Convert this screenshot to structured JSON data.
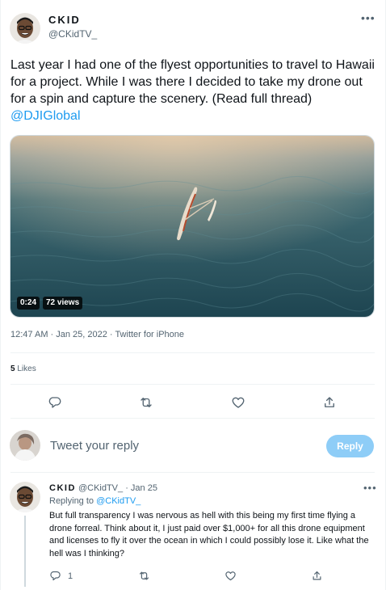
{
  "tweet": {
    "display_name": "CKID",
    "handle": "@CKidTV_",
    "text_before": "Last year I had one of the flyest opportunities to travel to Hawaii for a project. While I was there I decided to take my drone out for a spin and capture the scenery. (Read full thread) ",
    "mention": "@DJIGlobal",
    "video": {
      "duration": "0:24",
      "views": "72 views"
    },
    "timestamp": "12:47 AM · Jan 25, 2022 · Twitter for iPhone",
    "likes_count": "5",
    "likes_label": "Likes"
  },
  "reply_box": {
    "placeholder": "Tweet your reply",
    "button_label": "Reply"
  },
  "thread_reply": {
    "display_name": "CKID",
    "handle": "@CKidTV_",
    "date": "· Jan 25",
    "replying_prefix": "Replying to ",
    "replying_handle": "@CKidTV_",
    "text": "But full transparency I was nervous as hell with this being my first time flying a drone forreal. Think about it, I just paid over $1,000+ for all this drone equipment and licenses to fly it over the ocean in which I could possibly lose it. Like what the hell was I thinking?",
    "reply_count": "1"
  },
  "colors": {
    "accent": "#1d9bf0",
    "reply_button": "#8ecdf7",
    "secondary_text": "#536471",
    "divider": "#eff3f4"
  }
}
